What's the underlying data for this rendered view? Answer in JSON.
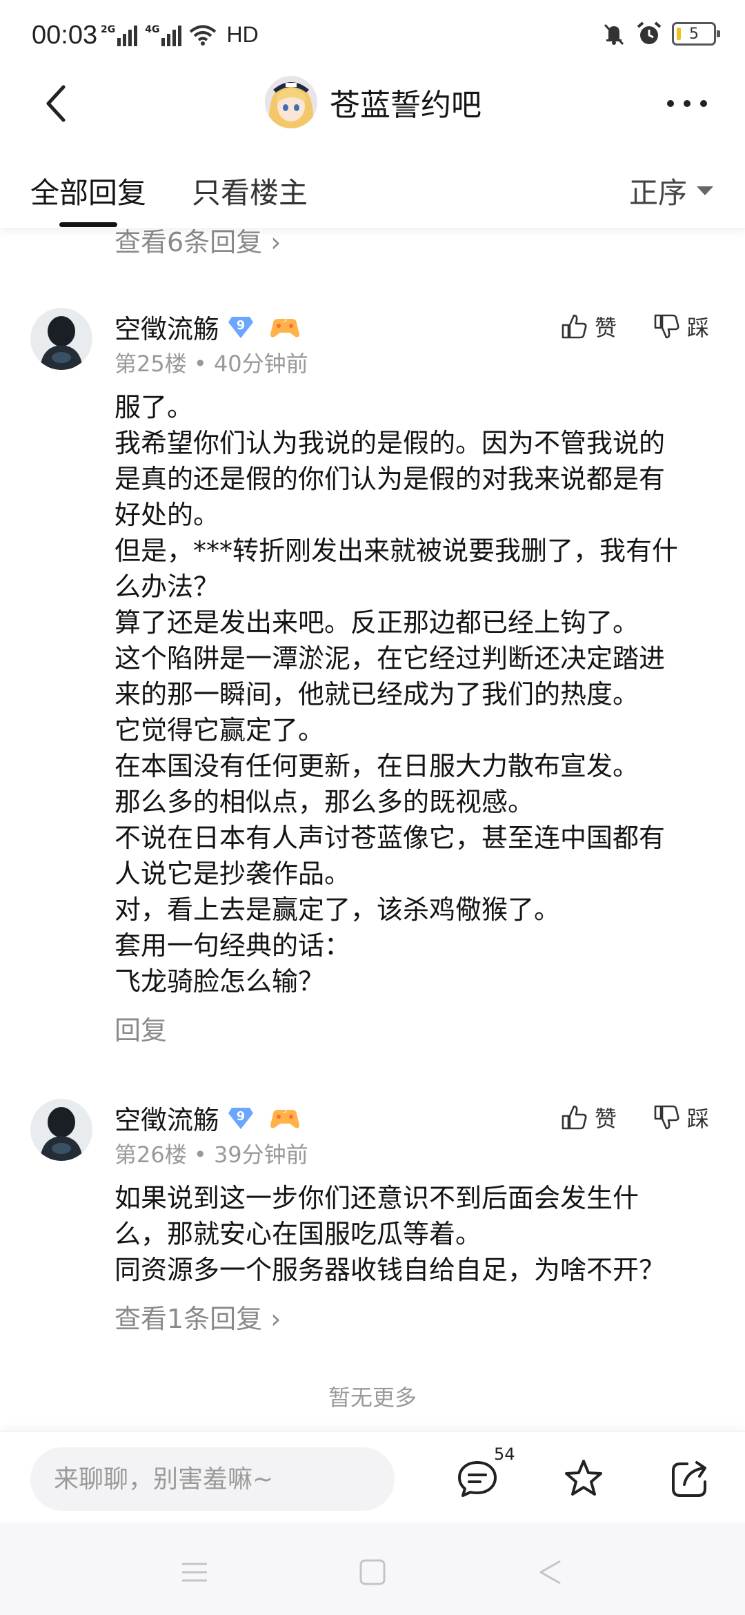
{
  "status_bar": {
    "time": "00:03",
    "network_1": "2G",
    "network_2": "4G",
    "hd_label": "HD",
    "battery": "5"
  },
  "header": {
    "forum_name": "苍蓝誓约吧"
  },
  "tabs": {
    "all_replies": "全部回复",
    "owner_only": "只看楼主",
    "sort_label": "正序"
  },
  "previous": {
    "view_replies": "查看6条回复 ›"
  },
  "posts": [
    {
      "username": "空徵流觞",
      "level": "9",
      "meta": "第25楼 • 40分钟前",
      "like_label": "赞",
      "dislike_label": "踩",
      "lines": [
        "服了。",
        "我希望你们认为我说的是假的。因为不管我说的",
        "是真的还是假的你们认为是假的对我来说都是有",
        "好处的。",
        "但是，***转折刚发出来就被说要我删了，我有什",
        "么办法？",
        "算了还是发出来吧。反正那边都已经上钩了。",
        "这个陷阱是一潭淤泥，在它经过判断还决定踏进",
        "来的那一瞬间，他就已经成为了我们的热度。",
        "它觉得它赢定了。",
        "在本国没有任何更新，在日服大力散布宣发。",
        "那么多的相似点，那么多的既视感。",
        "不说在日本有人声讨苍蓝像它，甚至连中国都有",
        "人说它是抄袭作品。",
        "对，看上去是赢定了，该杀鸡儆猴了。",
        "套用一句经典的话：",
        "飞龙骑脸怎么输？"
      ],
      "reply_label": "回复"
    },
    {
      "username": "空徵流觞",
      "level": "9",
      "meta": "第26楼 • 39分钟前",
      "like_label": "赞",
      "dislike_label": "踩",
      "lines": [
        "如果说到这一步你们还意识不到后面会发生什",
        "么，那就安心在国服吃瓜等着。",
        "同资源多一个服务器收钱自给自足，为啥不开？"
      ],
      "reply_label": "查看1条回复 ›"
    }
  ],
  "footer": {
    "no_more": "暂无更多",
    "input_placeholder": "来聊聊，别害羞嘛~",
    "comment_count": "54"
  },
  "icons": {
    "back": "back-arrow-icon",
    "more": "more-dots-icon",
    "like": "thumbs-up-icon",
    "dislike": "thumbs-down-icon",
    "comment": "comment-bubble-icon",
    "favorite": "star-icon",
    "share": "share-icon"
  },
  "colors": {
    "level_badge": "#6aa6ff",
    "game_badge": "#ffb14a",
    "meta_text": "#999999",
    "battery_fill": "#f0c020"
  }
}
